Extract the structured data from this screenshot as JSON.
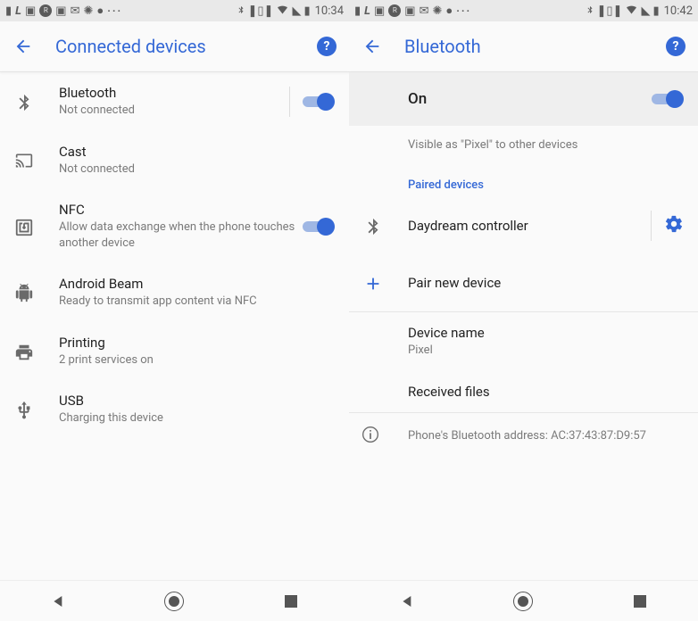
{
  "left": {
    "status": {
      "time": "10:34",
      "icons_left": [
        "battery",
        "L",
        "square1",
        "rave",
        "square2",
        "gmail",
        "brightness",
        "dot"
      ],
      "icons_right": [
        "bluetooth",
        "vibrate",
        "wifi",
        "signal",
        "battery"
      ]
    },
    "header": {
      "title": "Connected devices"
    },
    "items": [
      {
        "icon": "bluetooth",
        "title": "Bluetooth",
        "sub": "Not connected",
        "toggle": true,
        "separator": true
      },
      {
        "icon": "cast",
        "title": "Cast",
        "sub": "Not connected"
      },
      {
        "icon": "nfc",
        "title": "NFC",
        "sub": "Allow data exchange when the phone touches another device",
        "toggle": true
      },
      {
        "icon": "android",
        "title": "Android Beam",
        "sub": "Ready to transmit app content via NFC"
      },
      {
        "icon": "print",
        "title": "Printing",
        "sub": "2 print services on"
      },
      {
        "icon": "usb",
        "title": "USB",
        "sub": "Charging this device"
      }
    ]
  },
  "right": {
    "status": {
      "time": "10:42"
    },
    "header": {
      "title": "Bluetooth"
    },
    "switch": {
      "label": "On",
      "on": true
    },
    "visible_text": "Visible as \"Pixel\" to other devices",
    "section_header": "Paired devices",
    "paired": {
      "icon": "bluetooth",
      "label": "Daydream controller"
    },
    "pair_new": {
      "label": "Pair new device"
    },
    "device_name": {
      "title": "Device name",
      "value": "Pixel"
    },
    "received_files": {
      "title": "Received files"
    },
    "info": {
      "text": "Phone's Bluetooth address: AC:37:43:87:D9:57"
    }
  }
}
